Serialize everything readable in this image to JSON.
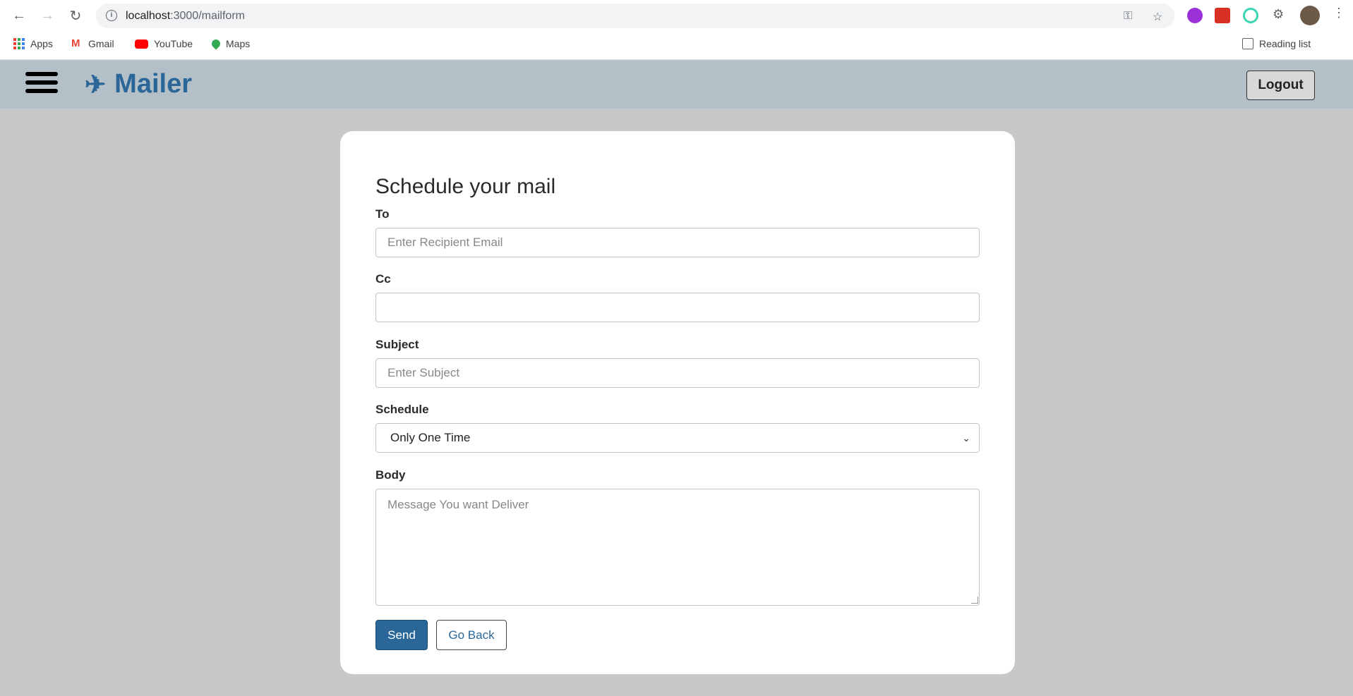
{
  "browser": {
    "url_host": "localhost",
    "url_path": ":3000/mailform",
    "bookmarks": [
      {
        "label": "Apps",
        "icon": "apps-grid-icon"
      },
      {
        "label": "Gmail",
        "icon": "gmail-icon"
      },
      {
        "label": "YouTube",
        "icon": "youtube-icon"
      },
      {
        "label": "Maps",
        "icon": "maps-icon"
      }
    ],
    "reading_list": "Reading list"
  },
  "navbar": {
    "brand": "Mailer",
    "logout_label": "Logout",
    "colors": {
      "bar": "#b4c0c8",
      "brand": "#2b6698"
    }
  },
  "form": {
    "title": "Schedule your mail",
    "to": {
      "label": "To",
      "placeholder": "Enter Recipient Email",
      "value": ""
    },
    "cc": {
      "label": "Cc",
      "placeholder": "",
      "value": ""
    },
    "subject": {
      "label": "Subject",
      "placeholder": "Enter Subject",
      "value": ""
    },
    "schedule": {
      "label": "Schedule",
      "selected": "Only One Time"
    },
    "body": {
      "label": "Body",
      "placeholder": "Message You want Deliver",
      "value": ""
    },
    "send_label": "Send",
    "back_label": "Go Back"
  }
}
